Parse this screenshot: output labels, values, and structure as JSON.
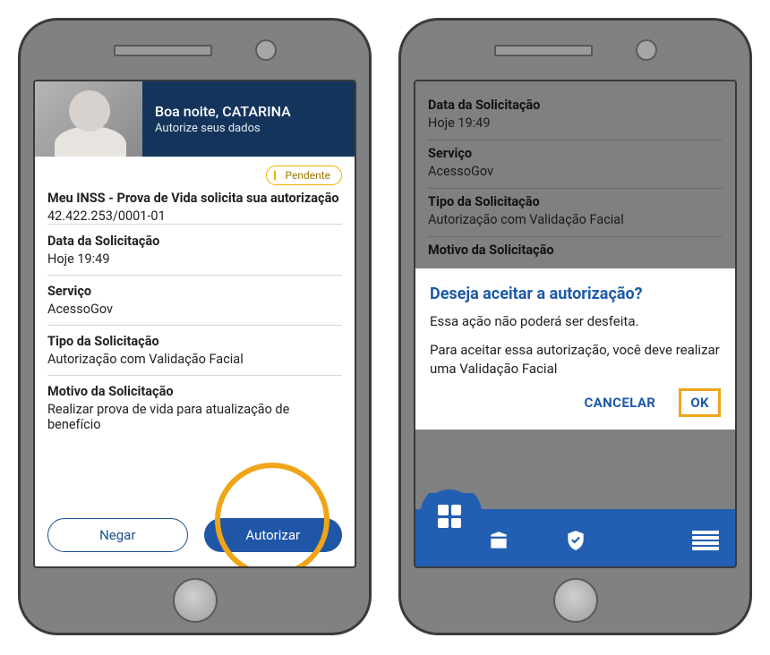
{
  "phone1": {
    "header": {
      "greeting": "Boa noite, CATARINA",
      "subtitle": "Autorize seus dados"
    },
    "status_badge": "Pendente",
    "request_title": "Meu INSS - Prova de Vida solicita sua autorização",
    "cnpj": "42.422.253/0001-01",
    "sections": {
      "data_label": "Data da Solicitação",
      "data_value": "Hoje 19:49",
      "servico_label": "Serviço",
      "servico_value": "AcessoGov",
      "tipo_label": "Tipo da Solicitação",
      "tipo_value": "Autorização com Validação Facial",
      "motivo_label": "Motivo da Solicitação",
      "motivo_value": "Realizar prova de vida para atualização de benefício"
    },
    "actions": {
      "deny": "Negar",
      "approve": "Autorizar"
    }
  },
  "phone2": {
    "behind": {
      "data_label": "Data da Solicitação",
      "data_value": "Hoje 19:49",
      "servico_label": "Serviço",
      "servico_value": "AcessoGov",
      "tipo_label": "Tipo da Solicitação",
      "tipo_value": "Autorização com Validação Facial",
      "motivo_label": "Motivo da Solicitação"
    },
    "dialog": {
      "title": "Deseja aceitar a autorização?",
      "line1": "Essa ação não poderá ser desfeita.",
      "line2": "Para aceitar essa autorização, você deve realizar uma Validação Facial",
      "cancel": "CANCELAR",
      "ok": "OK"
    }
  }
}
